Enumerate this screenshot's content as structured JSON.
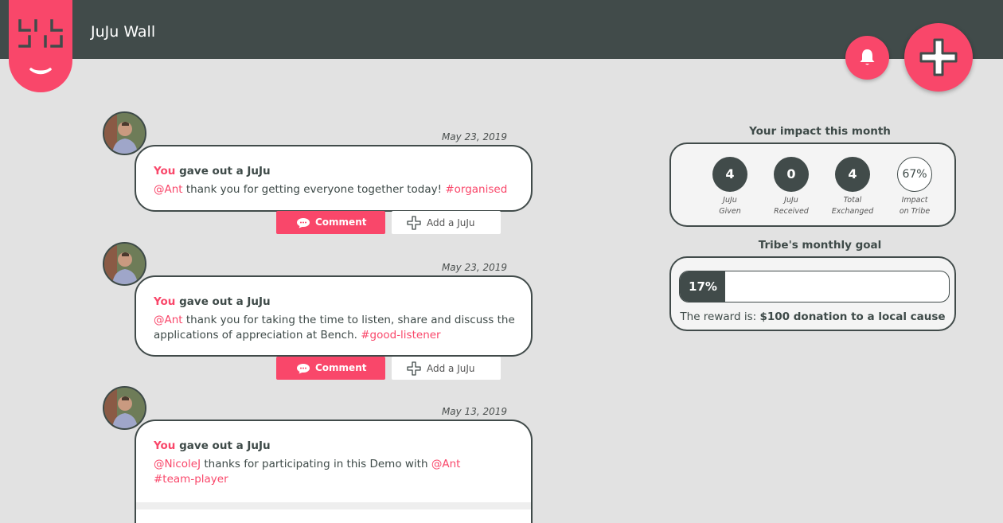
{
  "header": {
    "title": "JuJu Wall",
    "logo_icon": "juju-logo-icon",
    "notifications_icon": "bell-icon",
    "add_icon": "plus-icon"
  },
  "colors": {
    "accent": "#f9476a",
    "dark": "#414b4a",
    "background": "#e2e2e2"
  },
  "posts": [
    {
      "date": "May 23, 2019",
      "actor": "You",
      "action": "gave out a JuJu",
      "mention": "@Ant",
      "text": " thank you for getting everyone together today! ",
      "tag": "#organised",
      "comment_label": "Comment",
      "addjuju_label": "Add a JuJu"
    },
    {
      "date": "May 23, 2019",
      "actor": "You",
      "action": "gave out a JuJu",
      "mention": "@Ant",
      "text": " thank you for taking the time to listen, share and discuss the applications of appreciation at Bench. ",
      "tag": "#good-listener",
      "comment_label": "Comment",
      "addjuju_label": "Add a JuJu"
    },
    {
      "date": "May 13, 2019",
      "actor": "You",
      "action": "gave out a JuJu",
      "mention": "@NicoleJ",
      "text": " thanks for participating in this Demo with ",
      "mention2": "@Ant",
      "tag": "#team-player"
    }
  ],
  "impact": {
    "title": "Your impact this month",
    "stats": [
      {
        "value": "4",
        "label_line1": "JuJu",
        "label_line2": "Given"
      },
      {
        "value": "0",
        "label_line1": "JuJu",
        "label_line2": "Received"
      },
      {
        "value": "4",
        "label_line1": "Total",
        "label_line2": "Exchanged"
      },
      {
        "value": "67%",
        "label_line1": "Impact",
        "label_line2": "on Tribe"
      }
    ]
  },
  "goal": {
    "title": "Tribe's monthly goal",
    "progress_label": "17%",
    "progress_fraction": 0.17,
    "reward_prefix": "The reward is: ",
    "reward_value": "$100 donation to a local cause"
  }
}
